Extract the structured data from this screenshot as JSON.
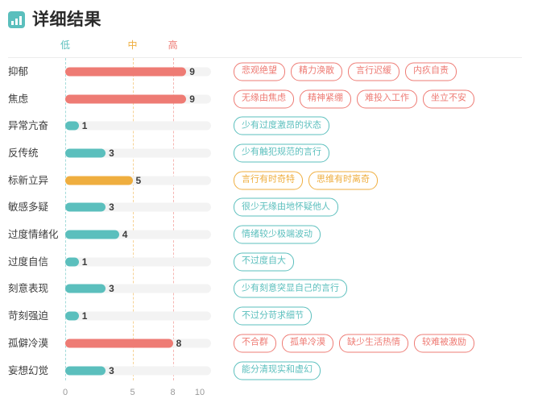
{
  "header": {
    "icon": "bar-chart-icon",
    "title": "详细结果"
  },
  "colors": {
    "low": "#5bbfbd",
    "medium": "#efae3f",
    "high": "#ee7b74",
    "track": "#f3f3f3",
    "label_text": "#3c3c3c",
    "tick_text": "#9a9a9a",
    "rule": "#ececec"
  },
  "chart_data": {
    "type": "bar",
    "title": "详细结果",
    "xlabel": "",
    "ylabel": "",
    "xlim": [
      0,
      10
    ],
    "grid": true,
    "orientation": "horizontal",
    "xticks": [
      "0",
      "5",
      "8",
      "10"
    ],
    "xtick_values": [
      0,
      5,
      8,
      10
    ],
    "zone_labels": [
      {
        "text": "低",
        "value": 0,
        "color": "#5bbfbd"
      },
      {
        "text": "中",
        "value": 5,
        "color": "#efae3f"
      },
      {
        "text": "高",
        "value": 8,
        "color": "#ee7b74"
      }
    ],
    "categories": [
      "抑郁",
      "焦虑",
      "异常亢奋",
      "反传统",
      "标新立异",
      "敏感多疑",
      "过度情绪化",
      "过度自信",
      "刻意表现",
      "苛刻强迫",
      "孤僻冷漠",
      "妄想幻觉"
    ],
    "values": [
      9,
      9,
      1,
      3,
      5,
      3,
      4,
      1,
      3,
      1,
      8,
      3
    ],
    "rows": [
      {
        "label": "抑郁",
        "value": 9,
        "level": "high",
        "color": "#ee7b74",
        "tags": [
          "悲观绝望",
          "精力涣散",
          "言行迟缓",
          "内疚自责"
        ]
      },
      {
        "label": "焦虑",
        "value": 9,
        "level": "high",
        "color": "#ee7b74",
        "tags": [
          "无缘由焦虑",
          "精神紧绷",
          "难投入工作",
          "坐立不安"
        ]
      },
      {
        "label": "异常亢奋",
        "value": 1,
        "level": "low",
        "color": "#5bbfbd",
        "tags": [
          "少有过度激昂的状态"
        ]
      },
      {
        "label": "反传统",
        "value": 3,
        "level": "low",
        "color": "#5bbfbd",
        "tags": [
          "少有触犯规范的言行"
        ]
      },
      {
        "label": "标新立异",
        "value": 5,
        "level": "medium",
        "color": "#efae3f",
        "tags": [
          "言行有时奇特",
          "思维有时离奇"
        ]
      },
      {
        "label": "敏感多疑",
        "value": 3,
        "level": "low",
        "color": "#5bbfbd",
        "tags": [
          "很少无缘由地怀疑他人"
        ]
      },
      {
        "label": "过度情绪化",
        "value": 4,
        "level": "low",
        "color": "#5bbfbd",
        "tags": [
          "情绪较少极端波动"
        ]
      },
      {
        "label": "过度自信",
        "value": 1,
        "level": "low",
        "color": "#5bbfbd",
        "tags": [
          "不过度自大"
        ]
      },
      {
        "label": "刻意表现",
        "value": 3,
        "level": "low",
        "color": "#5bbfbd",
        "tags": [
          "少有刻意突显自己的言行"
        ]
      },
      {
        "label": "苛刻强迫",
        "value": 1,
        "level": "low",
        "color": "#5bbfbd",
        "tags": [
          "不过分苛求细节"
        ]
      },
      {
        "label": "孤僻冷漠",
        "value": 8,
        "level": "high",
        "color": "#ee7b74",
        "tags": [
          "不合群",
          "孤单冷漠",
          "缺少生活热情",
          "较难被激励"
        ]
      },
      {
        "label": "妄想幻觉",
        "value": 3,
        "level": "low",
        "color": "#5bbfbd",
        "tags": [
          "能分清现实和虚幻"
        ]
      }
    ]
  }
}
